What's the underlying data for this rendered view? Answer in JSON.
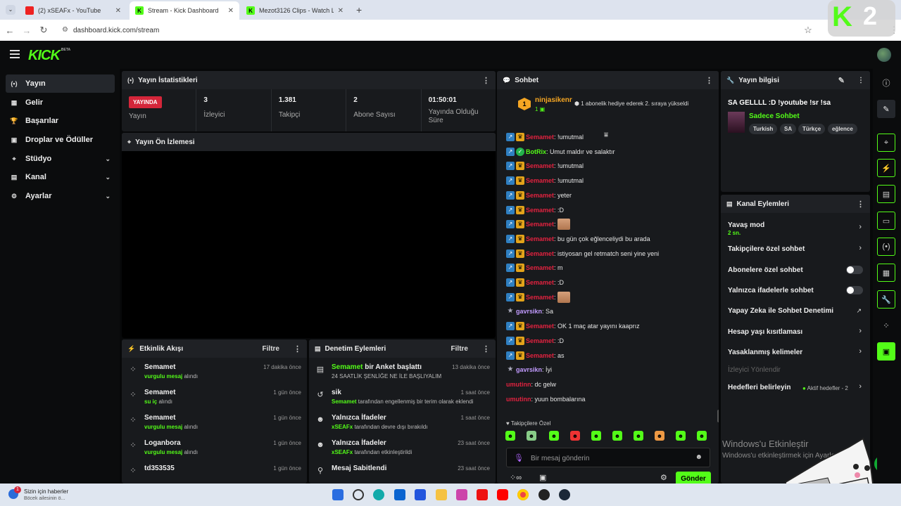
{
  "browser": {
    "tabs": [
      {
        "title": "(2) xSEAFx - YouTube",
        "fav": "youtube-icon"
      },
      {
        "title": "Stream - Kick Dashboard",
        "fav": "kick-icon"
      },
      {
        "title": "Mezot3126 Clips - Watch Live o",
        "fav": "kick-icon"
      }
    ],
    "url": "dashboard.kick.com/stream"
  },
  "topnav": {
    "logo": "KICK",
    "logo_beta": "BETA"
  },
  "sidebar": {
    "items": [
      {
        "label": "Yayın",
        "icon": "broadcast-icon",
        "active": true
      },
      {
        "label": "Gelir",
        "icon": "revenue-icon"
      },
      {
        "label": "Başarılar",
        "icon": "trophy-icon"
      },
      {
        "label": "Droplar ve Ödüller",
        "icon": "gift-icon"
      },
      {
        "label": "Stüdyo",
        "icon": "studio-icon",
        "expandable": true
      },
      {
        "label": "Kanal",
        "icon": "channel-icon",
        "expandable": true
      },
      {
        "label": "Ayarlar",
        "icon": "settings-icon",
        "expandable": true
      }
    ]
  },
  "stats": {
    "title": "Yayın İstatistikleri",
    "live_badge": "YAYINDA",
    "items": [
      {
        "value": "",
        "label": "Yayın"
      },
      {
        "value": "3",
        "label": "İzleyici"
      },
      {
        "value": "1.381",
        "label": "Takipçi"
      },
      {
        "value": "2",
        "label": "Abone Sayısı"
      },
      {
        "value": "01:50:01",
        "label": "Yayında Olduğu Süre"
      }
    ]
  },
  "preview": {
    "title": "Yayın Ön İzlemesi"
  },
  "activity": {
    "title": "Etkinlik Akışı",
    "filter": "Filtre",
    "rows": [
      {
        "name": "Semamet",
        "time": "17 dakika önce",
        "hl": "vurgulu mesaj",
        "rest": " alındı"
      },
      {
        "name": "Semamet",
        "time": "1 gün önce",
        "hl": "su iç",
        "rest": " alındı"
      },
      {
        "name": "Semamet",
        "time": "1 gün önce",
        "hl": "vurgulu mesaj",
        "rest": " alındı"
      },
      {
        "name": "Loganbora",
        "time": "1 gün önce",
        "hl": "vurgulu mesaj",
        "rest": " alındı"
      },
      {
        "name": "td353535",
        "time": "1 gün önce",
        "hl": "",
        "rest": ""
      }
    ]
  },
  "moderation": {
    "title": "Denetim Eylemleri",
    "filter": "Filtre",
    "rows": [
      {
        "name": "Semamet",
        "action": " bir Anket başlattı",
        "time": "13 dakika önce",
        "sub_hl": "",
        "sub": "24 SAATLİK ŞENLİĞE NE İLE BAŞLIYALIM"
      },
      {
        "name": "",
        "action": "sik",
        "time": "1 saat önce",
        "sub_hl": "Semamet",
        "sub": " tarafından engellenmiş bir terim olarak eklendi"
      },
      {
        "name": "",
        "action": "Yalnızca İfadeler",
        "time": "1 saat önce",
        "sub_hl": "xSEAFx",
        "sub": " tarafından devre dışı bırakıldı"
      },
      {
        "name": "",
        "action": "Yalnızca İfadeler",
        "time": "23 saat önce",
        "sub_hl": "xSEAFx",
        "sub": " tarafından etkinleştirildi"
      },
      {
        "name": "",
        "action": "Mesaj Sabitlendi",
        "time": "23 saat önce",
        "sub_hl": "",
        "sub": ""
      }
    ]
  },
  "chat": {
    "title": "Sohbet",
    "pinned": {
      "rank": "1",
      "name": "ninjasikenr",
      "sub": "1",
      "message": "1 abonelik hediye ederek 2. sıraya yükseldi"
    },
    "messages": [
      {
        "user": "Semamet",
        "text": ": !umutmal",
        "color": "red",
        "badges": [
          "blue",
          "gold"
        ]
      },
      {
        "user": "BotRix",
        "text": ": Umut maldır ve salaktır",
        "color": "green",
        "badges": [
          "blue",
          "green"
        ]
      },
      {
        "user": "Semamet",
        "text": ": !umutmal",
        "color": "red",
        "badges": [
          "blue",
          "gold"
        ]
      },
      {
        "user": "Semamet",
        "text": ": !umutmal",
        "color": "red",
        "badges": [
          "blue",
          "gold"
        ]
      },
      {
        "user": "Semamet",
        "text": ": yeter",
        "color": "red",
        "badges": [
          "blue",
          "gold"
        ]
      },
      {
        "user": "Semamet",
        "text": ": :D",
        "color": "red",
        "badges": [
          "blue",
          "gold"
        ]
      },
      {
        "user": "Semamet",
        "text": ":",
        "color": "red",
        "badges": [
          "blue",
          "gold"
        ],
        "emote": true
      },
      {
        "user": "Semamet",
        "text": ": bu gün çok eğlenceliydi bu arada",
        "color": "red",
        "badges": [
          "blue",
          "gold"
        ]
      },
      {
        "user": "Semamet",
        "text": ": istiyosan gel retmatch seni yine yeni",
        "color": "red",
        "badges": [
          "blue",
          "gold"
        ]
      },
      {
        "user": "Semamet",
        "text": ": m",
        "color": "red",
        "badges": [
          "blue",
          "gold"
        ]
      },
      {
        "user": "Semamet",
        "text": ": :D",
        "color": "red",
        "badges": [
          "blue",
          "gold"
        ]
      },
      {
        "user": "Semamet",
        "text": ":",
        "color": "red",
        "badges": [
          "blue",
          "gold"
        ],
        "emote": true
      },
      {
        "user": "gavrsikn",
        "text": ": Sa",
        "color": "lav",
        "badges": [
          "star"
        ]
      },
      {
        "user": "Semamet",
        "text": ": OK 1 maç atar yayını kaaprız",
        "color": "red",
        "badges": [
          "blue",
          "gold"
        ]
      },
      {
        "user": "Semamet",
        "text": ": :D",
        "color": "red",
        "badges": [
          "blue",
          "gold"
        ]
      },
      {
        "user": "Semamet",
        "text": ": as",
        "color": "red",
        "badges": [
          "blue",
          "gold"
        ]
      },
      {
        "user": "gavrsikn",
        "text": ": İyi",
        "color": "lav",
        "badges": [
          "star"
        ]
      },
      {
        "user": "umutinn",
        "text": ": dc gelw",
        "color": "red2",
        "badges": []
      },
      {
        "user": "umutinn",
        "text": ": yuun bombalarına",
        "color": "red2",
        "badges": []
      }
    ],
    "followers_only": "Takipçilere Özel",
    "input_placeholder": "Bir mesaj gönderin",
    "send": "Gönder"
  },
  "info": {
    "title": "Yayın bilgisi",
    "stream_title": "SA GELLLL :D !youtube !sr !sa",
    "category": "Sadece Sohbet",
    "tags": [
      "Turkish",
      "SA",
      "Türkçe",
      "eğlence"
    ]
  },
  "actions": {
    "title": "Kanal Eylemleri",
    "items": [
      {
        "label": "Yavaş mod",
        "sub": "2 sn.",
        "kind": "chev"
      },
      {
        "label": "Takipçilere özel sohbet",
        "kind": "chev"
      },
      {
        "label": "Abonelere özel sohbet",
        "kind": "toggle"
      },
      {
        "label": "Yalnızca ifadelerle sohbet",
        "kind": "toggle"
      },
      {
        "label": "Yapay Zeka ile Sohbet Denetimi",
        "kind": "ext"
      },
      {
        "label": "Hesap yaşı kısıtlaması",
        "kind": "chev"
      },
      {
        "label": "Yasaklanmış kelimeler",
        "kind": "chev"
      },
      {
        "label": "İzleyici Yönlendir",
        "kind": "dim"
      },
      {
        "label": "Hedefleri belirleyin",
        "extra": "Aktif hedefler - 2",
        "kind": "chev"
      }
    ]
  },
  "windows": {
    "activate_title": "Windows'u Etkinleştir",
    "activate_sub": "Windows'u etkinleştirmek için Ayarlar'a gidin."
  },
  "taskbar": {
    "news_badge": "1",
    "news_title": "Sizin için haberler",
    "news_sub": "Böcek ailesinin ö..."
  },
  "overlay": {
    "k": "K",
    "n": "2"
  },
  "colors": {
    "accent": "#53fc18",
    "live": "#d4263a",
    "panel": "#181a1d"
  }
}
